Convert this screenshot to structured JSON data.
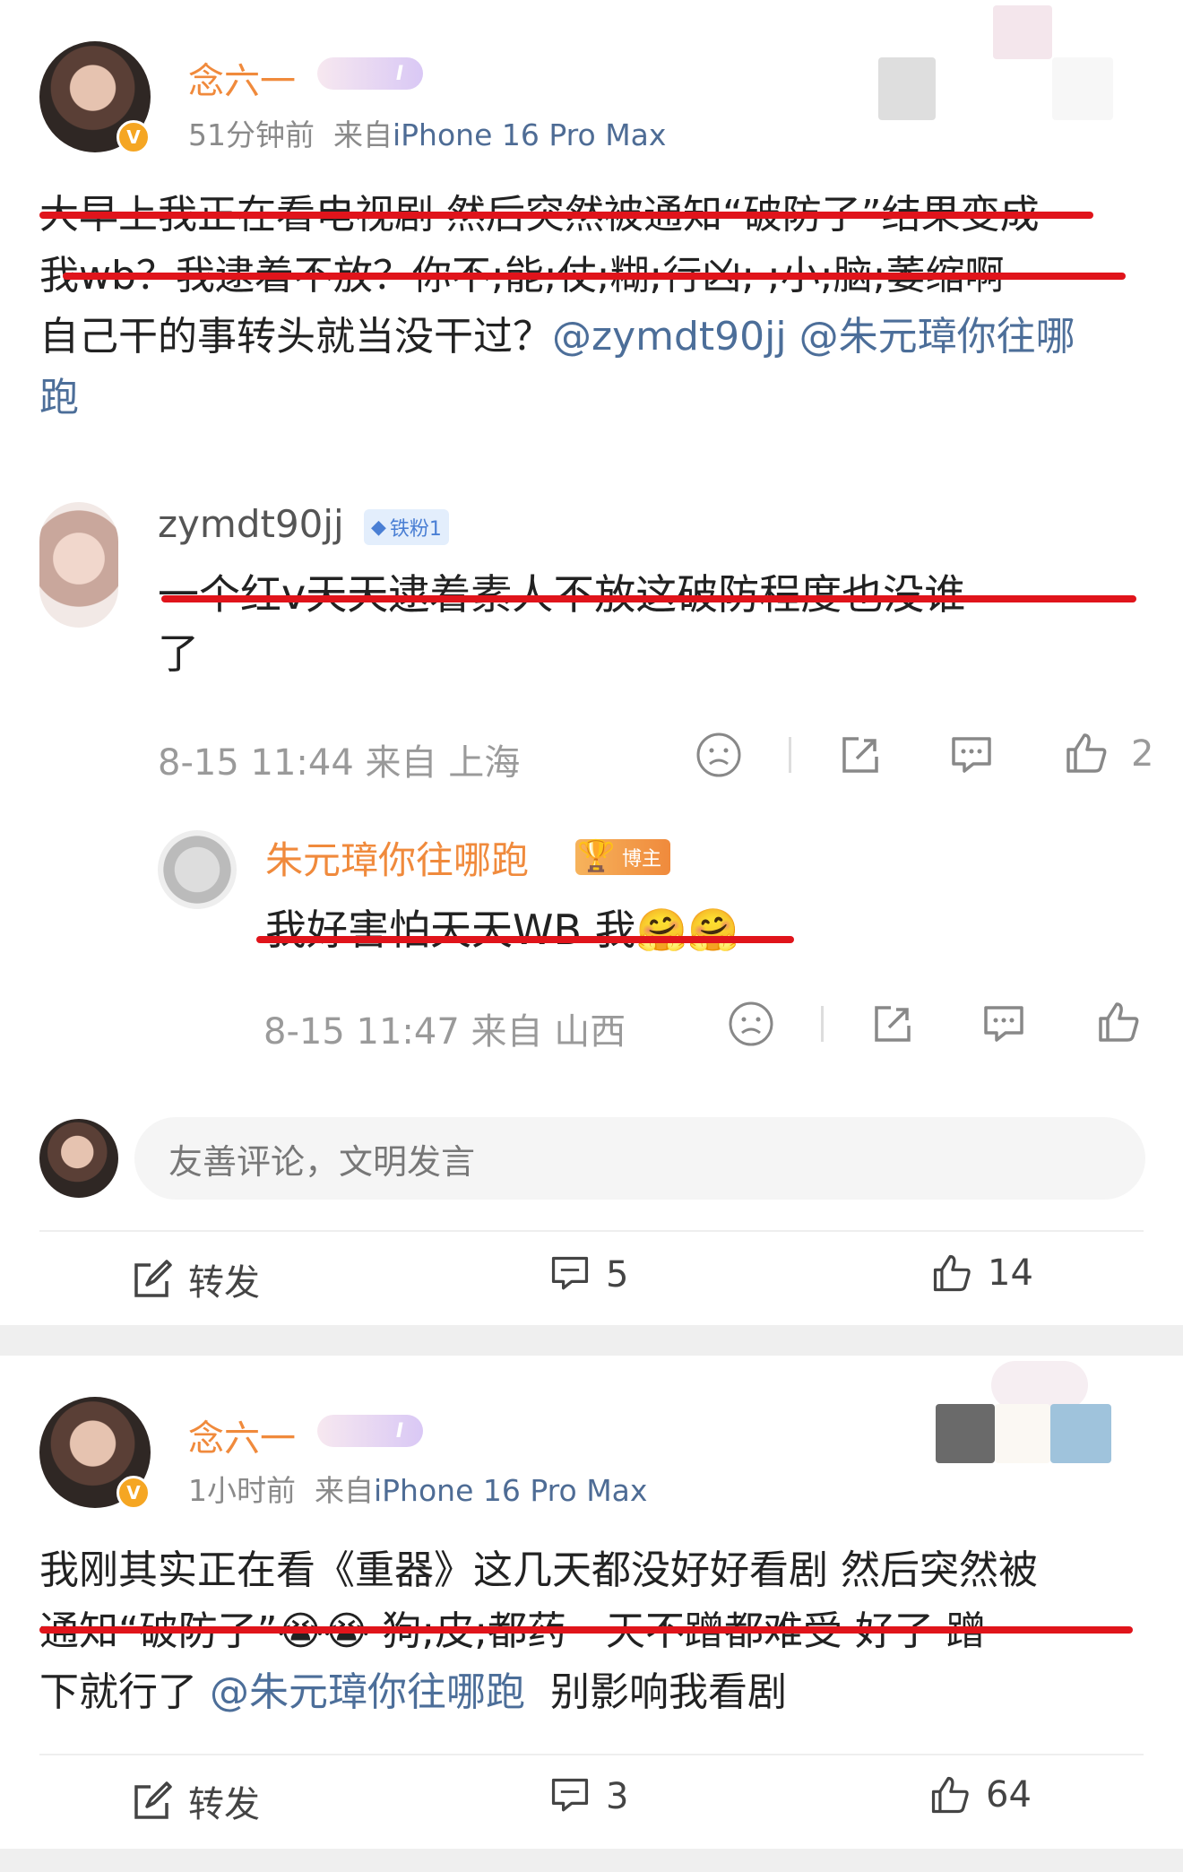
{
  "post1": {
    "author": "念六一",
    "level": "I",
    "time": "51分钟前",
    "from_label": "来自",
    "device": "iPhone 16 Pro Max",
    "text_lines": [
      "大早上我正在看电视剧 然后突然被通知“破防了”结果变成",
      "我wb？我逮着不放？你不;能;仗;糊;行凶;·;小;脑;萎缩啊",
      "自己干的事转头就当没干过？"
    ],
    "mention1": "@zymdt90jj",
    "mention2_line1": "@朱元璋你往哪",
    "mention2_line2": "跑",
    "reply1": {
      "name": "zymdt90jj",
      "badge": "铁粉1",
      "text_line1": "一个红v天天逮着素人不放这破防程度也没谁",
      "text_line2": "了",
      "time": "8-15 11:44",
      "from_label": "来自",
      "location": "上海",
      "like_partial": "2"
    },
    "reply2": {
      "name": "朱元璋你往哪跑",
      "badge": "博主",
      "text": "我好害怕天天WB 我",
      "emoji": "🤗🤗",
      "time": "8-15 11:47",
      "from_label": "来自",
      "location": "山西"
    },
    "comment_placeholder": "友善评论，文明发言",
    "actions": {
      "repost_label": "转发",
      "comments": "5",
      "likes": "14"
    }
  },
  "post2": {
    "author": "念六一",
    "level": "I",
    "time": "1小时前",
    "from_label": "来自",
    "device": "iPhone 16 Pro Max",
    "line1": "我刚其实正在看《重器》这几天都没好好看剧 然后突然被",
    "line2": "通知“破防了”😭😭 狗;皮;都药一天不蹭都难受 好了 蹭一",
    "line3_pre": "下就行了",
    "mention": "@朱元璋你往哪跑",
    "line3_post": "别影响我看剧",
    "actions": {
      "repost_label": "转发",
      "comments": "3",
      "likes": "64"
    }
  },
  "colors": {
    "username": "#f08a3c",
    "mention": "#4c6e99",
    "strike": "#e0141b",
    "meta": "#8a8a8a"
  }
}
